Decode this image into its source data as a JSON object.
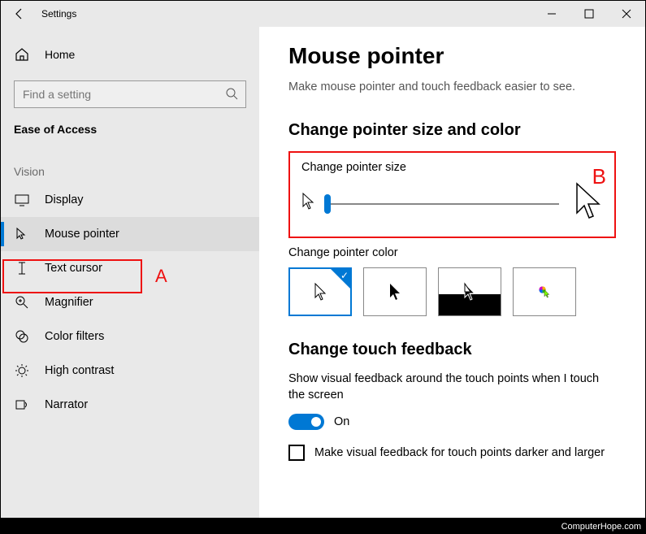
{
  "window": {
    "title": "Settings"
  },
  "sidebar": {
    "home": "Home",
    "search_placeholder": "Find a setting",
    "category": "Ease of Access",
    "group": "Vision",
    "items": [
      {
        "label": "Display"
      },
      {
        "label": "Mouse pointer"
      },
      {
        "label": "Text cursor"
      },
      {
        "label": "Magnifier"
      },
      {
        "label": "Color filters"
      },
      {
        "label": "High contrast"
      },
      {
        "label": "Narrator"
      }
    ]
  },
  "main": {
    "heading": "Mouse pointer",
    "subtitle": "Make mouse pointer and touch feedback easier to see.",
    "section_size_color": "Change pointer size and color",
    "pointer_size_label": "Change pointer size",
    "pointer_color_label": "Change pointer color",
    "section_touch": "Change touch feedback",
    "touch_text": "Show visual feedback around the touch points when I touch the screen",
    "toggle_state": "On",
    "checkbox_label": "Make visual feedback for touch points darker and larger"
  },
  "annotations": {
    "a": "A",
    "b": "B"
  },
  "footer": "ComputerHope.com"
}
